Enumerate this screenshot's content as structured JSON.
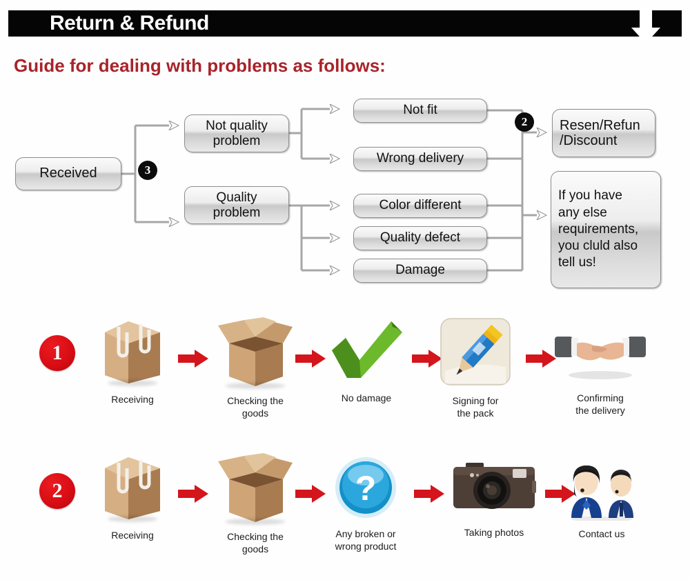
{
  "header": {
    "title": "Return & Refund",
    "arrow_icon": "down-arrow-icon",
    "bar_color": "#050505"
  },
  "guide": {
    "heading": "Guide for dealing with problems as follows:",
    "color": "#a8242a"
  },
  "flowchart": {
    "nodes": {
      "received": "Received",
      "not_quality_problem": "Not quality\nproblem",
      "quality_problem": "Quality\nproblem",
      "not_fit": "Not fit",
      "wrong_delivery": "Wrong delivery",
      "color_different": "Color different",
      "quality_defect": "Quality defect",
      "damage": "Damage",
      "resend": "Resen/Refun\n/Discount",
      "else_requirements": "If you have\nany else\nrequirements,\nyou cluld also\ntell us!"
    },
    "badges": {
      "three": "3",
      "two": "2"
    }
  },
  "process_rows": [
    {
      "number": "1",
      "steps": [
        {
          "icon": "sealed-box-icon",
          "label": "Receiving"
        },
        {
          "icon": "open-box-icon",
          "label": "Checking the\ngoods"
        },
        {
          "icon": "green-check-icon",
          "label": "No damage"
        },
        {
          "icon": "pencil-sign-icon",
          "label": "Signing for\nthe pack"
        },
        {
          "icon": "handshake-icon",
          "label": "Confirming\nthe delivery"
        }
      ]
    },
    {
      "number": "2",
      "steps": [
        {
          "icon": "sealed-box-icon",
          "label": "Receiving"
        },
        {
          "icon": "open-box-icon",
          "label": "Checking the\ngoods"
        },
        {
          "icon": "question-mark-icon",
          "label": "Any broken or\nwrong product"
        },
        {
          "icon": "camera-icon",
          "label": "Taking photos"
        },
        {
          "icon": "support-staff-icon",
          "label": "Contact us"
        }
      ]
    }
  ],
  "colors": {
    "red_accent": "#d90d14",
    "heading_red": "#a8242a",
    "node_border": "#8e8e8e",
    "connector": "#a6a6a6"
  }
}
